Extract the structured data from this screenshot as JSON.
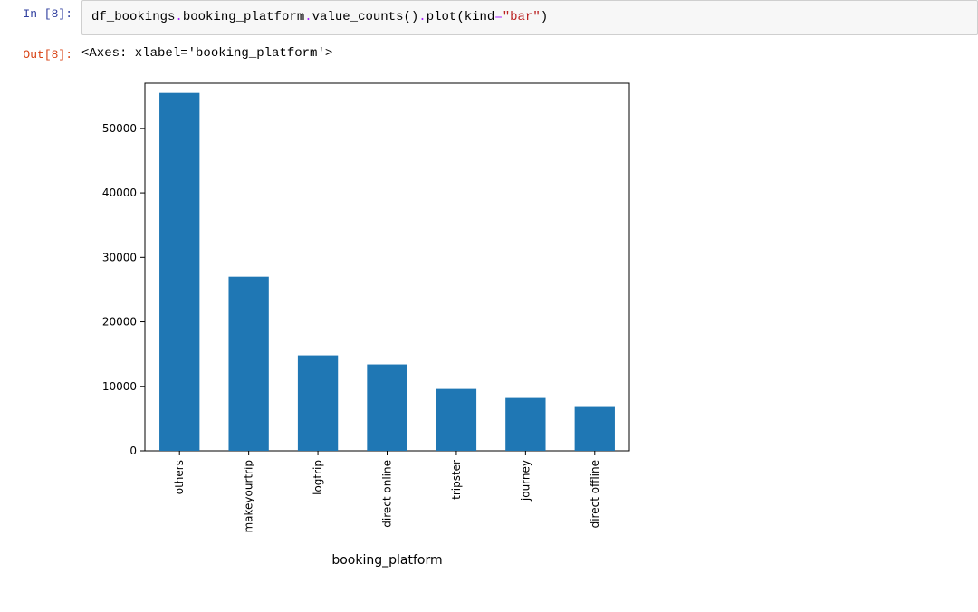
{
  "cell": {
    "in_prompt": "In [8]:",
    "out_prompt": "Out[8]:",
    "code_tokens": {
      "var": "df_bookings",
      "attr1": "booking_platform",
      "attr2": "value_counts",
      "attr3": "plot",
      "kw_name": "kind",
      "kw_value": "\"bar\""
    },
    "output_text": "<Axes: xlabel='booking_platform'>"
  },
  "chart_data": {
    "type": "bar",
    "categories": [
      "others",
      "makeyourtrip",
      "logtrip",
      "direct online",
      "tripster",
      "journey",
      "direct offline"
    ],
    "values": [
      55500,
      27000,
      14800,
      13400,
      9600,
      8200,
      6800
    ],
    "xlabel": "booking_platform",
    "ylabel": "",
    "yticks": [
      0,
      10000,
      20000,
      30000,
      40000,
      50000
    ],
    "ylim": [
      0,
      57000
    ],
    "series_name": "booking_platform"
  },
  "colors": {
    "bar": "#1f77b4",
    "axis": "#000000",
    "code_bg": "#f7f7f7",
    "code_border": "#cfcfcf"
  }
}
